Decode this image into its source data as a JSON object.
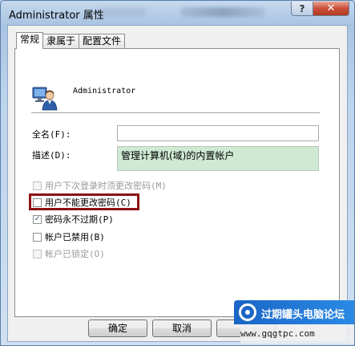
{
  "window": {
    "title": "Administrator 属性",
    "help_glyph": "?",
    "close_glyph": "✕"
  },
  "tabs": [
    {
      "label": "常规",
      "active": true
    },
    {
      "label": "隶属于",
      "active": false
    },
    {
      "label": "配置文件",
      "active": false
    }
  ],
  "user": {
    "icon": "user-account-icon",
    "name": "Administrator"
  },
  "fields": {
    "fullname": {
      "label": "全名(F):",
      "value": ""
    },
    "description": {
      "label": "描述(D):",
      "value": "管理计算机(域)的内置帐户"
    }
  },
  "options": [
    {
      "label": "用户下次登录时须更改密码(M)",
      "checked": false,
      "enabled": false
    },
    {
      "label": "用户不能更改密码(C)",
      "checked": false,
      "enabled": true,
      "highlighted": true
    },
    {
      "label": "密码永不过期(P)",
      "checked": true,
      "enabled": true
    },
    {
      "label": "帐户已禁用(B)",
      "checked": false,
      "enabled": true
    },
    {
      "label": "帐户已锁定(O)",
      "checked": false,
      "enabled": false
    }
  ],
  "buttons": {
    "ok": "确定",
    "cancel": "取消"
  },
  "watermark": {
    "title": "过期罐头电脑论坛",
    "url": "www.gqgtpc.com"
  },
  "colors": {
    "highlight_border": "#8b1214",
    "description_bg": "#cfe9d3",
    "close_button": "#c9503a"
  }
}
